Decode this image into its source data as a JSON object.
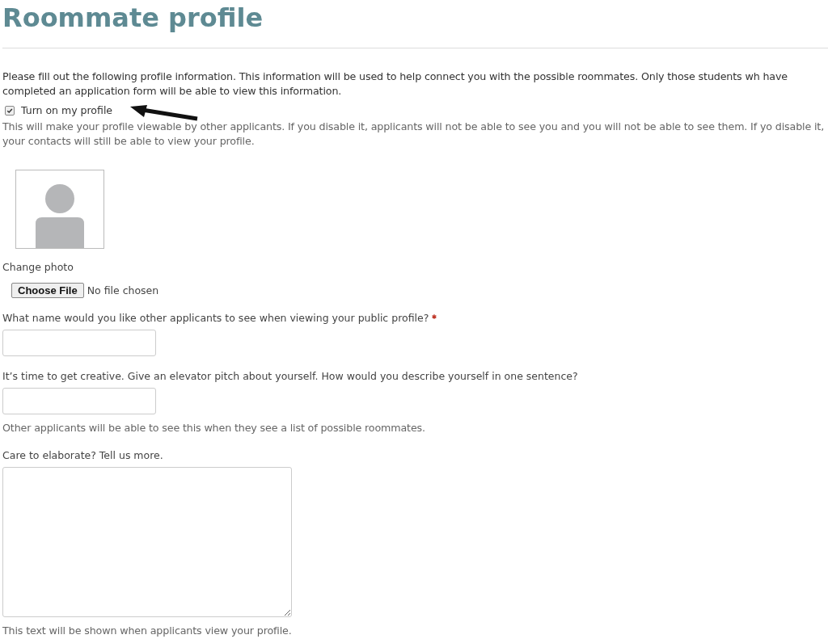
{
  "title": "Roommate profile",
  "intro": "Please fill out the following profile information. This information will be used to help connect you with the possible roommates. Only those students wh have completed an application form will be able to view this information.",
  "profile_toggle": {
    "label": "Turn on my profile",
    "checked": true
  },
  "toggle_help": "This will make your profile viewable by other applicants. If you disable it, applicants will not be able to see you and you will not be able to see them. If yo disable it, your contacts will still be able to view your profile.",
  "photo": {
    "label": "Change photo",
    "button": "Choose File",
    "status": "No file chosen"
  },
  "fields": [
    {
      "kind": "input",
      "label": "What name would you like other applicants to see when viewing your public profile?",
      "required": true
    },
    {
      "kind": "input",
      "label": "It’s time to get creative. Give an elevator pitch about yourself. How would you describe yourself in one sentence?",
      "required": false,
      "help": "Other applicants will be able to see this when they see a list of possible roommates."
    },
    {
      "kind": "textarea",
      "label": "Care to elaborate? Tell us more.",
      "required": false,
      "help": "This text will be shown when applicants view your profile."
    }
  ]
}
